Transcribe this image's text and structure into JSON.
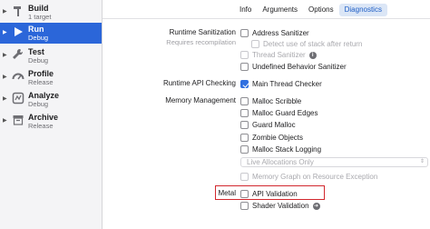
{
  "sidebar": {
    "items": [
      {
        "title": "Build",
        "subtitle": "1 target",
        "icon": "hammer-icon",
        "selected": false
      },
      {
        "title": "Run",
        "subtitle": "Debug",
        "icon": "play-icon",
        "selected": true
      },
      {
        "title": "Test",
        "subtitle": "Debug",
        "icon": "wrench-icon",
        "selected": false
      },
      {
        "title": "Profile",
        "subtitle": "Release",
        "icon": "gauge-icon",
        "selected": false
      },
      {
        "title": "Analyze",
        "subtitle": "Debug",
        "icon": "analyze-icon",
        "selected": false
      },
      {
        "title": "Archive",
        "subtitle": "Release",
        "icon": "archive-icon",
        "selected": false
      }
    ]
  },
  "tabs": [
    "Info",
    "Arguments",
    "Options",
    "Diagnostics"
  ],
  "active_tab": "Diagnostics",
  "sections": {
    "runtime_sanitization": {
      "label": "Runtime Sanitization",
      "sublabel": "Requires recompilation",
      "options": [
        {
          "label": "Address Sanitizer",
          "checked": false,
          "enabled": true
        },
        {
          "label": "Detect use of stack after return",
          "checked": false,
          "enabled": false
        },
        {
          "label": "Thread Sanitizer",
          "checked": false,
          "enabled": false,
          "info": true
        },
        {
          "label": "Undefined Behavior Sanitizer",
          "checked": false,
          "enabled": true
        }
      ]
    },
    "runtime_api": {
      "label": "Runtime API Checking",
      "options": [
        {
          "label": "Main Thread Checker",
          "checked": true,
          "enabled": true
        }
      ]
    },
    "memory_management": {
      "label": "Memory Management",
      "options": [
        {
          "label": "Malloc Scribble",
          "checked": false,
          "enabled": true
        },
        {
          "label": "Malloc Guard Edges",
          "checked": false,
          "enabled": true
        },
        {
          "label": "Guard Malloc",
          "checked": false,
          "enabled": true
        },
        {
          "label": "Zombie Objects",
          "checked": false,
          "enabled": true
        },
        {
          "label": "Malloc Stack Logging",
          "checked": false,
          "enabled": true
        }
      ],
      "popup_value": "Live Allocations Only",
      "memory_graph": {
        "label": "Memory Graph on Resource Exception",
        "checked": false,
        "enabled": false
      }
    },
    "metal": {
      "label": "Metal",
      "options": [
        {
          "label": "API Validation",
          "checked": false,
          "enabled": true
        },
        {
          "label": "Shader Validation",
          "checked": false,
          "enabled": true
        }
      ]
    }
  },
  "colors": {
    "accent": "#2b66d9",
    "highlight": "#d2282e"
  }
}
